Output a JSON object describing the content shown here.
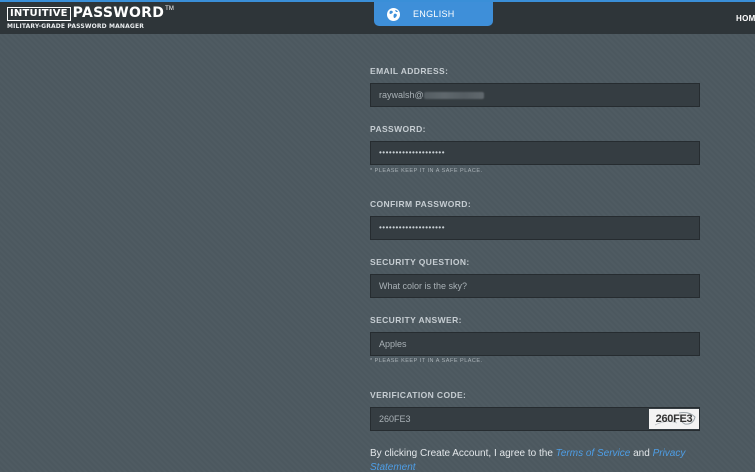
{
  "header": {
    "logo_box": "INTUITIVE",
    "logo_word": "PASSWORD",
    "logo_tm": "TM",
    "logo_sub": "MILITARY-GRADE PASSWORD MANAGER",
    "language_label": "ENGLISH",
    "home_link": "HOM"
  },
  "form": {
    "email": {
      "label": "EMAIL ADDRESS:",
      "value": "raywalsh@"
    },
    "password": {
      "label": "PASSWORD:",
      "value": "••••••••••••••••••••",
      "hint": "* PLEASE KEEP IT IN A SAFE PLACE."
    },
    "confirm": {
      "label": "CONFIRM PASSWORD:",
      "value": "••••••••••••••••••••"
    },
    "question": {
      "label": "SECURITY QUESTION:",
      "value": "What color is the sky?"
    },
    "answer": {
      "label": "SECURITY ANSWER:",
      "value": "Apples",
      "hint": "* PLEASE KEEP IT IN A SAFE PLACE."
    },
    "verification": {
      "label": "VERIFICATION CODE:",
      "value": "260FE3",
      "captcha": "260FE3"
    }
  },
  "terms": {
    "prefix": "By clicking Create Account, I agree to the ",
    "tos": "Terms of Service",
    "and": " and ",
    "privacy": "Privacy Statement"
  },
  "colors": {
    "accent": "#3e8fd9",
    "background": "#4d5960",
    "topbar": "#2e3539",
    "field": "#353d42"
  }
}
